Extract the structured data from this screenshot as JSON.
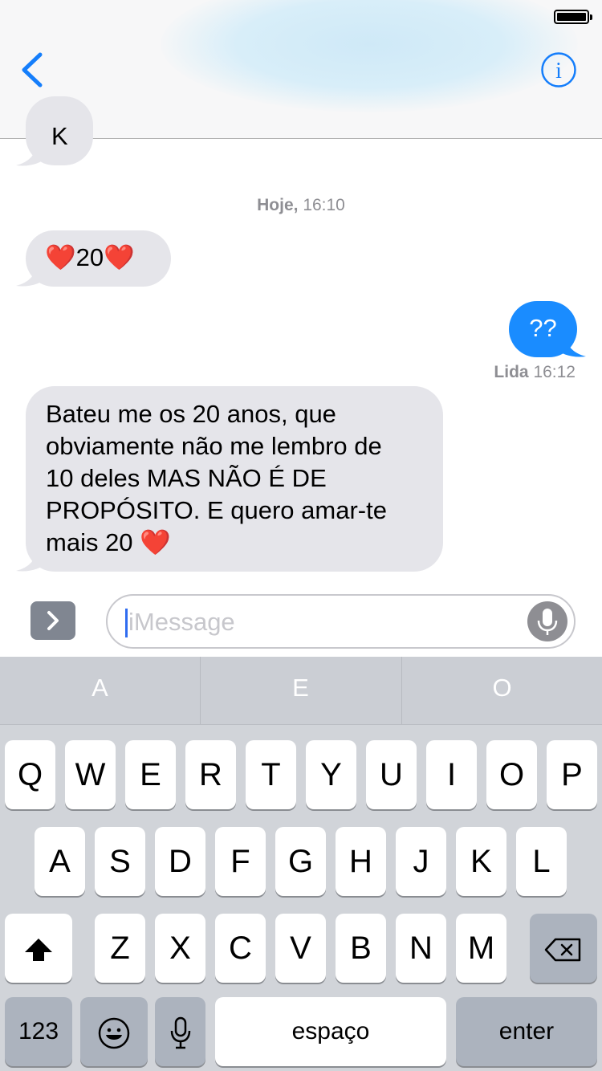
{
  "header": {
    "back_icon": "chevron-left-icon",
    "info_icon": "info-circle-icon",
    "accent_color": "#157efb"
  },
  "conversation": {
    "partial_message_text": "k",
    "timestamp_day": "Hoje,",
    "timestamp_time": "16:10",
    "messages": [
      {
        "direction": "incoming",
        "text": "❤️20❤️"
      },
      {
        "direction": "outgoing",
        "text": "??"
      },
      {
        "direction": "incoming",
        "text": "Bateu me os 20 anos, que\nobviamente não me lembro de\n10 deles MAS NÃO É DE\nPROPÓSITO. E quero amar-te\nmais 20 ❤️"
      }
    ],
    "read_status": "Lida",
    "read_time": "16:12",
    "incoming_color": "#e5e5ea",
    "outgoing_color": "#1a8cff"
  },
  "composer": {
    "apps_icon": "chevron-right-icon",
    "placeholder": "iMessage",
    "value": "",
    "mic_icon": "microphone-icon"
  },
  "keyboard": {
    "predictions": [
      "A",
      "E",
      "O"
    ],
    "row1": [
      "Q",
      "W",
      "E",
      "R",
      "T",
      "Y",
      "U",
      "I",
      "O",
      "P"
    ],
    "row2": [
      "A",
      "S",
      "D",
      "F",
      "G",
      "H",
      "J",
      "K",
      "L"
    ],
    "row3": [
      "Z",
      "X",
      "C",
      "V",
      "B",
      "N",
      "M"
    ],
    "shift_icon": "shift-arrow-icon",
    "delete_icon": "backspace-icon",
    "numbers_label": "123",
    "emoji_icon": "emoji-smiley-icon",
    "dictation_icon": "microphone-icon",
    "space_label": "espaço",
    "enter_label": "enter"
  }
}
